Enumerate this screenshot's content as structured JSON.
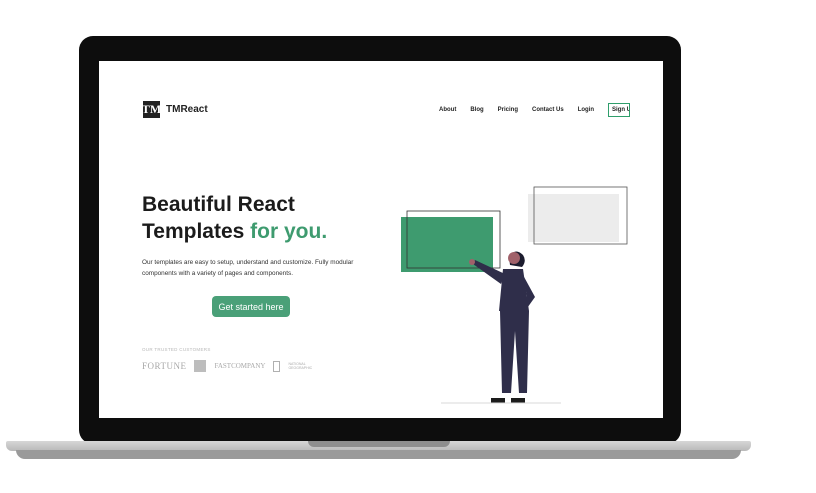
{
  "brand": {
    "name": "TMReact",
    "mark": "TM"
  },
  "nav": {
    "items": [
      "About",
      "Blog",
      "Pricing",
      "Contact Us",
      "Login"
    ],
    "signup": "Sign Up"
  },
  "hero": {
    "title_line1": "Beautiful React",
    "title_line2": "Templates",
    "title_accent": "for you.",
    "description": "Our templates are easy to setup, understand and customize. Fully modular components with a variety of pages and components.",
    "cta": "Get started here"
  },
  "customers": {
    "heading": "OUR TRUSTED CUSTOMERS",
    "logos": [
      "FORTUNE",
      "FASTCOMPANY",
      "NATIONAL GEOGRAPHIC"
    ]
  },
  "colors": {
    "accent": "#3e9b6f",
    "button": "#4aa078",
    "laptop": "#0d0d0d"
  }
}
